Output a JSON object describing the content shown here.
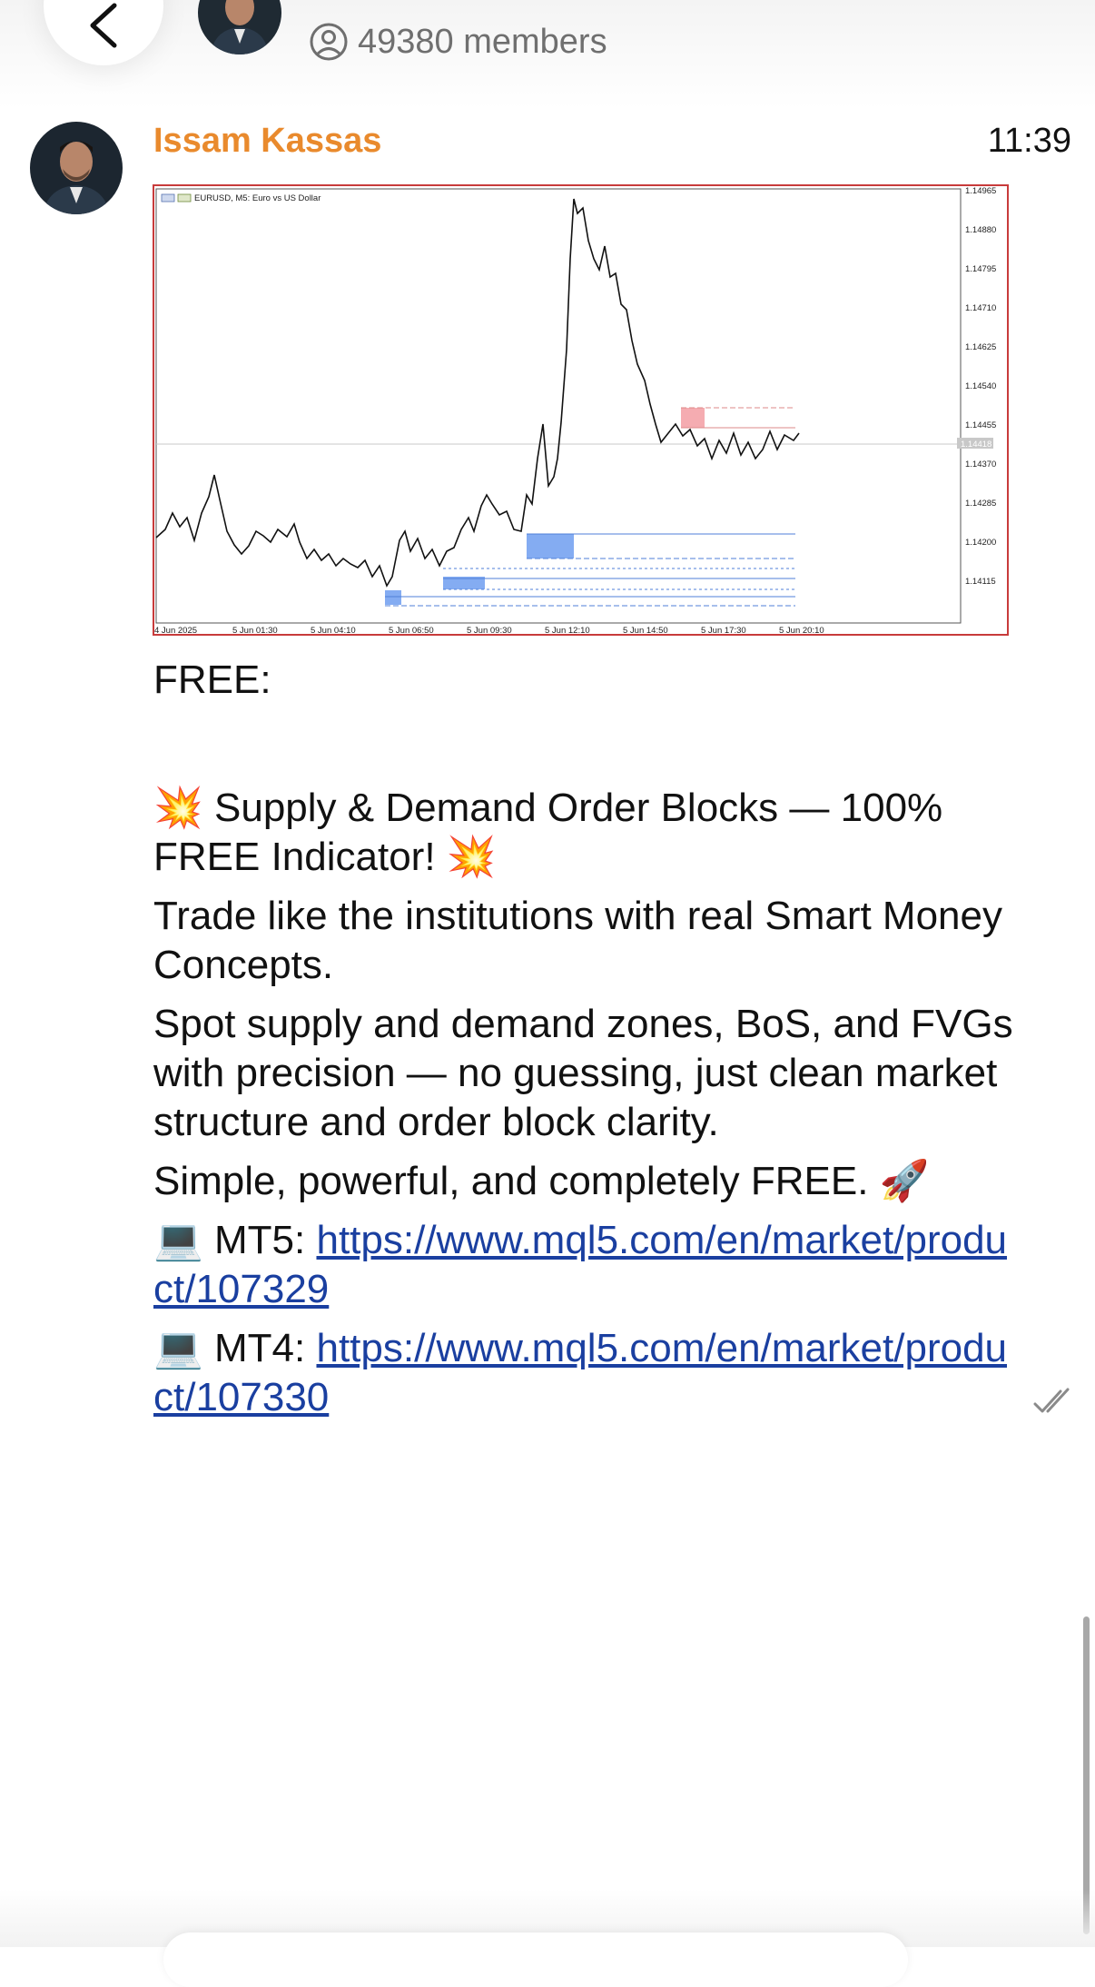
{
  "header": {
    "members_count": "49380 members"
  },
  "message": {
    "sender": "Issam Kassas",
    "time": "11:39",
    "chart": {
      "symbol_label": "EURUSD, M5:  Euro vs US Dollar",
      "price_ticks": [
        "1.14965",
        "1.14880",
        "1.14795",
        "1.14710",
        "1.14625",
        "1.14540",
        "1.14455",
        "1.14370",
        "1.14285",
        "1.14200",
        "1.14115"
      ],
      "current_price": "1.14418",
      "time_ticks": [
        "4 Jun 2025",
        "5 Jun 01:30",
        "5 Jun 04:10",
        "5 Jun 06:50",
        "5 Jun 09:30",
        "5 Jun 12:10",
        "5 Jun 14:50",
        "5 Jun 17:30",
        "5 Jun 20:10"
      ]
    },
    "text": {
      "line_free": "FREE:",
      "headline_emoji_start": "💥",
      "headline": " Supply & Demand Order Blocks — 100% FREE Indicator! ",
      "headline_emoji_end": "💥",
      "para1": "Trade like the institutions with real Smart Money Concepts.",
      "para2": " Spot supply and demand zones, BoS, and FVGs with precision — no guessing, just clean market structure and order block clarity.",
      "para3": " Simple, powerful, and completely FREE. ",
      "para3_emoji": "🚀",
      "mt5_emoji": "💻",
      "mt5_label": " MT5: ",
      "mt5_link": "https://www.mql5.com/en/market/product/107329",
      "mt4_emoji": " 💻",
      "mt4_label": " MT4: ",
      "mt4_link": "https://www.mql5.com/en/market/product/107330"
    }
  },
  "colors": {
    "sender": "#e98a2d",
    "link": "#1a3fa0",
    "demand_zone": "#6f9ef0",
    "supply_zone": "#f4a3a8"
  }
}
